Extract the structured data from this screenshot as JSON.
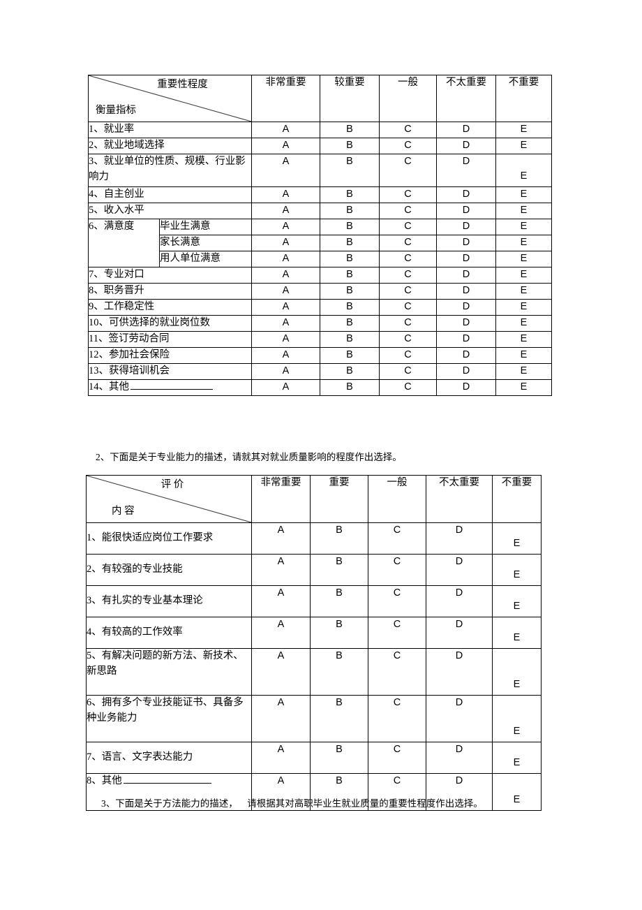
{
  "document": {
    "type": "questionnaire",
    "language": "zh-CN"
  },
  "table1": {
    "header": {
      "corner_top": "重要性程度",
      "corner_bottom": "衡量指标",
      "columns": [
        "非常重要",
        "较重要",
        "一般",
        "不太重要",
        "不重要"
      ]
    },
    "options": [
      "A",
      "B",
      "C",
      "D",
      "E"
    ],
    "rows": [
      {
        "label": "1、就业率",
        "lines": 1
      },
      {
        "label": "2、就业地域选择",
        "lines": 1
      },
      {
        "label": "3、就业单位的性质、规模、行业影响力",
        "lines": 2
      },
      {
        "label": "4、自主创业",
        "lines": 1
      },
      {
        "label": "5、收入水平",
        "lines": 1
      }
    ],
    "group": {
      "label": "6、满意度",
      "sub_rows": [
        "毕业生满意",
        "家长满意",
        "用人单位满意"
      ]
    },
    "rows_after": [
      {
        "label": "7、专业对口",
        "lines": 1
      },
      {
        "label": "8、职务晋升",
        "lines": 1
      },
      {
        "label": "9、工作稳定性",
        "lines": 1
      },
      {
        "label": "10、可供选择的就业岗位数",
        "lines": 1
      },
      {
        "label": "11、签订劳动合同",
        "lines": 1
      },
      {
        "label": "12、参加社会保险",
        "lines": 1
      },
      {
        "label": "13、获得培训机会",
        "lines": 1
      },
      {
        "label": "14、其他",
        "lines": 1,
        "blank": true
      }
    ]
  },
  "question2": {
    "text": "2、下面是关于专业能力的描述，请就其对就业质量影响的程度作出选择。"
  },
  "table2": {
    "header": {
      "corner_top": "评  价",
      "corner_bottom": "内  容",
      "columns": [
        "非常重要",
        "重要",
        "一般",
        "不太重要",
        "不重要"
      ]
    },
    "options": [
      "A",
      "B",
      "C",
      "D",
      "E"
    ],
    "rows": [
      {
        "label": "1、能很快适应岗位工作要求",
        "lines": 1
      },
      {
        "label": "2、有较强的专业技能",
        "lines": 1
      },
      {
        "label": "3、有扎实的专业基本理论",
        "lines": 1
      },
      {
        "label": "4、有较高的工作效率",
        "lines": 1
      },
      {
        "label": "5、有解决问题的新方法、新技术、新思路",
        "lines": 2
      },
      {
        "label": "6、拥有多个专业技能证书、具备多种业务能力",
        "lines": 2
      },
      {
        "label": "7、语言、文字表达能力",
        "lines": 1
      },
      {
        "label": "8、其他",
        "lines": 1,
        "blank": true
      }
    ]
  },
  "question3": {
    "text": "3、下面是关于方法能力的描述，    请根据其对高职毕业生就业质量的重要性程度作出选择。"
  }
}
